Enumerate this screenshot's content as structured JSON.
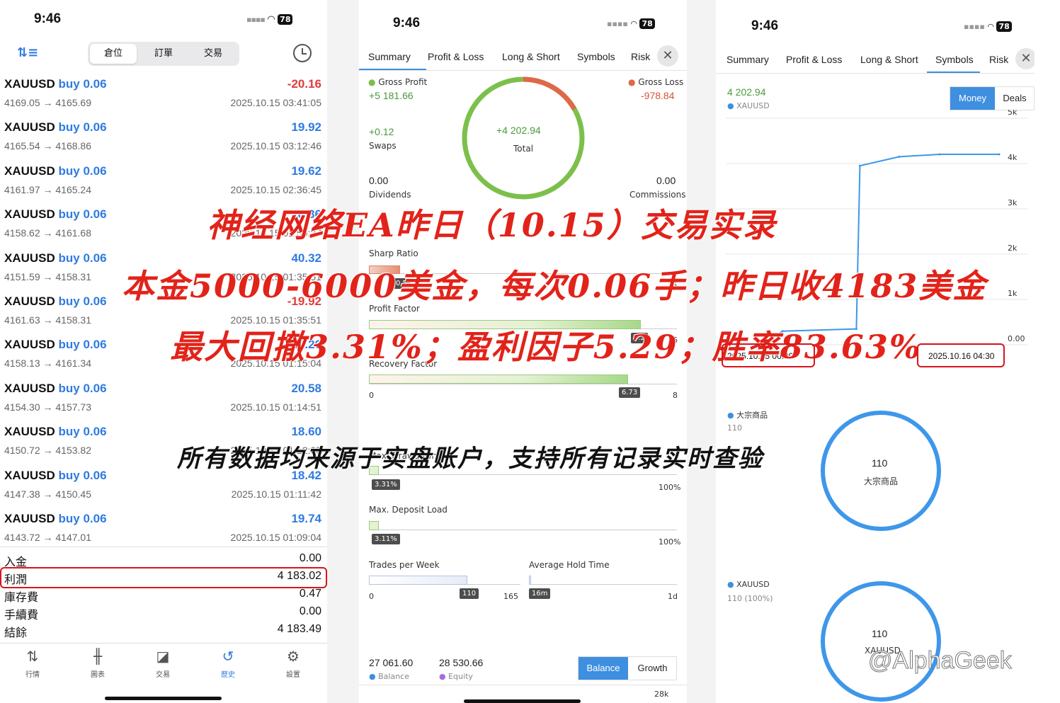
{
  "panel1": {
    "time": "9:46",
    "battery": "78",
    "tabs": [
      "倉位",
      "訂單",
      "交易"
    ],
    "trades": [
      {
        "symbol": "XAUUSD",
        "dir": "buy 0.06",
        "pnl": "-20.16",
        "prices": "4169.05 → 4165.69",
        "datetime": "2025.10.15 03:41:05"
      },
      {
        "symbol": "XAUUSD",
        "dir": "buy 0.06",
        "pnl": "19.92",
        "prices": "4165.54 → 4168.86",
        "datetime": "2025.10.15 03:12:46"
      },
      {
        "symbol": "XAUUSD",
        "dir": "buy 0.06",
        "pnl": "19.62",
        "prices": "4161.97 → 4165.24",
        "datetime": "2025.10.15 02:36:45"
      },
      {
        "symbol": "XAUUSD",
        "dir": "buy 0.06",
        "pnl": "18.36",
        "prices": "4158.62 → 4161.68",
        "datetime": "2025.10.15 01:50:27"
      },
      {
        "symbol": "XAUUSD",
        "dir": "buy 0.06",
        "pnl": "40.32",
        "prices": "4151.59 → 4158.31",
        "datetime": "2025.10.15 01:35:51"
      },
      {
        "symbol": "XAUUSD",
        "dir": "buy 0.06",
        "pnl": "-19.92",
        "prices": "4161.63 → 4158.31",
        "datetime": "2025.10.15 01:35:51"
      },
      {
        "symbol": "XAUUSD",
        "dir": "buy 0.06",
        "pnl": "19.26",
        "prices": "4158.13 → 4161.34",
        "datetime": "2025.10.15 01:15:04"
      },
      {
        "symbol": "XAUUSD",
        "dir": "buy 0.06",
        "pnl": "20.58",
        "prices": "4154.30 → 4157.73",
        "datetime": "2025.10.15 01:14:51"
      },
      {
        "symbol": "XAUUSD",
        "dir": "buy 0.06",
        "pnl": "18.60",
        "prices": "4150.72 → 4153.82",
        "datetime": "2025.10.15 01:12:05"
      },
      {
        "symbol": "XAUUSD",
        "dir": "buy 0.06",
        "pnl": "18.42",
        "prices": "4147.38 → 4150.45",
        "datetime": "2025.10.15 01:11:42"
      },
      {
        "symbol": "XAUUSD",
        "dir": "buy 0.06",
        "pnl": "19.74",
        "prices": "4143.72 → 4147.01",
        "datetime": "2025.10.15 01:09:04"
      }
    ],
    "summary": [
      {
        "label": "入金",
        "value": "0.00"
      },
      {
        "label": "利潤",
        "value": "4 183.02"
      },
      {
        "label": "庫存費",
        "value": "0.47"
      },
      {
        "label": "手續費",
        "value": "0.00"
      },
      {
        "label": "結餘",
        "value": "4 183.49"
      }
    ],
    "nav": [
      "行情",
      "圖表",
      "交易",
      "歷史",
      "設置"
    ]
  },
  "panel2": {
    "time": "9:46",
    "battery": "78",
    "tabs": [
      "Summary",
      "Profit & Loss",
      "Long & Short",
      "Symbols",
      "Risk"
    ],
    "gross_profit_label": "Gross Profit",
    "gross_profit": "+5 181.66",
    "gross_loss_label": "Gross Loss",
    "gross_loss": "-978.84",
    "total": "+4 202.94",
    "total_label": "Total",
    "swaps": "+0.12",
    "swaps_label": "Swaps",
    "dividends": "0.00",
    "dividends_label": "Dividends",
    "commissions": "0.00",
    "commissions_label": "Commissions",
    "sharp_label": "Sharp Ratio",
    "sharp_marker": "0.5",
    "sharp_max": "5",
    "sharp_value": 0.5,
    "sharp_scale": 5,
    "pf_label": "Profit Factor",
    "pf_marker": "5.2",
    "pf_max": "6",
    "pf_value": 5.29,
    "pf_scale": 6,
    "rf_label": "Recovery Factor",
    "rf_min": "0",
    "rf_marker": "6.73",
    "rf_max": "8",
    "rf_value": 6.73,
    "rf_scale": 8,
    "dd_label": "Max. Drawdown",
    "dd_marker": "3.31%",
    "dd_max": "100%",
    "dl_label": "Max. Deposit Load",
    "dl_marker": "3.11%",
    "dl_max": "100%",
    "tpw_label": "Trades per Week",
    "tpw_min": "0",
    "tpw_marker": "110",
    "tpw_max": "165",
    "aht_label": "Average Hold Time",
    "aht_marker": "16m",
    "aht_max": "1d",
    "balance": "27 061.60",
    "balance_label": "Balance",
    "equity": "28 530.66",
    "equity_label": "Equity",
    "btn_balance": "Balance",
    "btn_growth": "Growth",
    "axis_top": "28k",
    "colors": {
      "green": "#7cc04b",
      "red": "#e06848",
      "blue": "#3e8fe0",
      "purple": "#a76ce0"
    }
  },
  "panel3": {
    "time": "9:46",
    "battery": "78",
    "tabs": [
      "Summary",
      "Profit & Loss",
      "Long & Short",
      "Symbols",
      "Risk"
    ],
    "value": "4 202.94",
    "symbol": "XAUUSD",
    "btn_money": "Money",
    "btn_deals": "Deals",
    "chart_data": {
      "type": "line",
      "x": [
        "2025.10.15 00:30",
        "2025.10.15 01:09",
        "2025.10.15 01:50",
        "2025.10.15 02:30",
        "2025.10.15 03:00",
        "2025.10.15 03:40",
        "2025.10.16 04:30"
      ],
      "y": [
        0,
        300,
        350,
        3950,
        4150,
        4202.94,
        4202.94
      ],
      "yticks": [
        "5k",
        "4k",
        "3k",
        "2k",
        "1k",
        "0.00"
      ],
      "ylim": [
        0,
        5000
      ],
      "x_start_label": "2025.10.15 00:30",
      "x_end_label": "2025.10.16 04:30"
    },
    "cat1_label": "大宗商品",
    "cat1_count": "110",
    "cat1_center_value": "110",
    "cat1_center_label": "大宗商品",
    "cat2_label": "XAUUSD",
    "cat2_count": "110 (100%)",
    "cat2_center_value": "110",
    "cat2_center_label": "XAUUSD"
  },
  "overlay": {
    "line1": "神经网络EA昨日（10.15）交易实录",
    "line2": "本金5000-6000美金，每次0.06手；昨日收4183美金",
    "line3": "最大回撤3.31%；盈利因子5.29；胜率83.63%",
    "line4": "所有数据均来源于实盘账户，支持所有记录实时查验",
    "watermark": "@AlphaGeek"
  }
}
